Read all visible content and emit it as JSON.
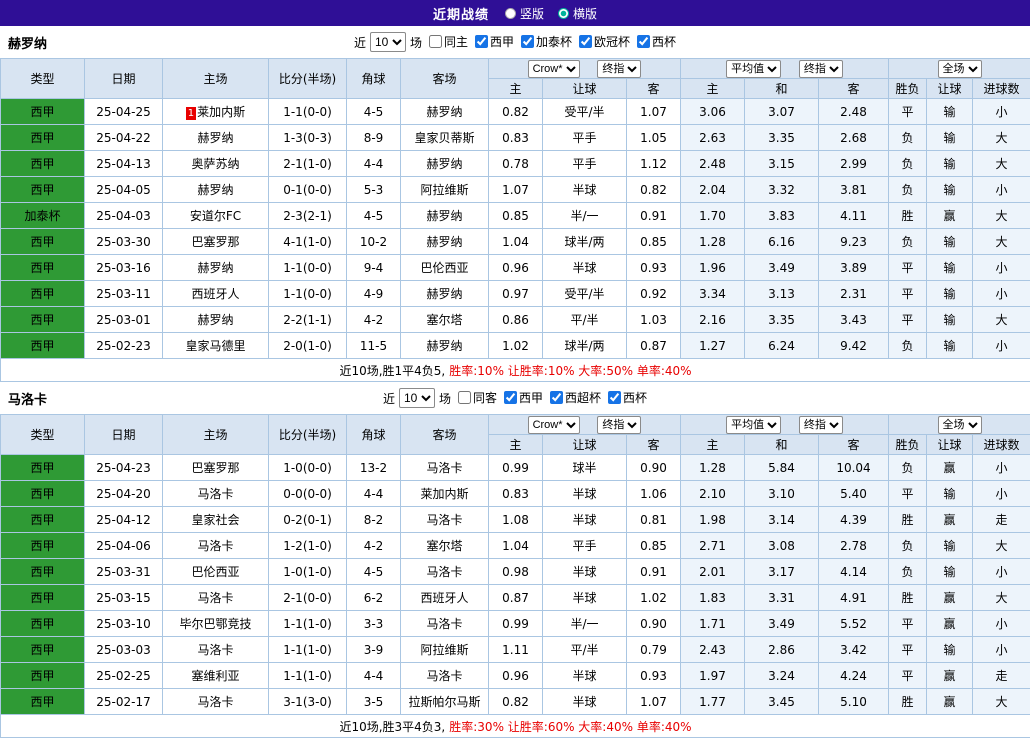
{
  "topbar": {
    "title": "近期战绩",
    "options": [
      {
        "label": "竖版",
        "selected": false
      },
      {
        "label": "横版",
        "selected": true
      }
    ]
  },
  "filter": {
    "near_label": "近",
    "count": "10",
    "games_label": "场"
  },
  "columns": {
    "type": "类型",
    "date": "日期",
    "home": "主场",
    "score": "比分(半场)",
    "corner": "角球",
    "away": "客场",
    "group1": {
      "selects": [
        "Crow*",
        "终指"
      ],
      "cols": [
        "主",
        "让球",
        "客"
      ]
    },
    "group2": {
      "selects": [
        "平均值",
        "终指"
      ],
      "cols": [
        "主",
        "和",
        "客"
      ]
    },
    "group3": {
      "selects": [
        "全场"
      ],
      "cols": [
        "胜负",
        "让球",
        "进球数"
      ]
    }
  },
  "sections": [
    {
      "team": "赫罗纳",
      "filter_checks": [
        {
          "label": "同主",
          "checked": false
        },
        {
          "label": "西甲",
          "checked": true
        },
        {
          "label": "加泰杯",
          "checked": true
        },
        {
          "label": "欧冠杯",
          "checked": true
        },
        {
          "label": "西杯",
          "checked": true
        }
      ],
      "rows": [
        {
          "type": "西甲",
          "date": "25-04-25",
          "home": "莱加内斯",
          "home_badge": "1",
          "score": "1-1(0-0)",
          "corner": "4-5",
          "away": "赫罗纳",
          "crow": [
            "0.82",
            "受平/半",
            "1.07"
          ],
          "avg": [
            "3.06",
            "3.07",
            "2.48"
          ],
          "result": [
            "平",
            "输",
            "小"
          ]
        },
        {
          "type": "西甲",
          "date": "25-04-22",
          "home": "赫罗纳",
          "score": "1-3(0-3)",
          "corner": "8-9",
          "away": "皇家贝蒂斯",
          "crow": [
            "0.83",
            "平手",
            "1.05"
          ],
          "avg": [
            "2.63",
            "3.35",
            "2.68"
          ],
          "result": [
            "负",
            "输",
            "大"
          ]
        },
        {
          "type": "西甲",
          "date": "25-04-13",
          "home": "奥萨苏纳",
          "score": "2-1(1-0)",
          "corner": "4-4",
          "away": "赫罗纳",
          "crow": [
            "0.78",
            "平手",
            "1.12"
          ],
          "avg": [
            "2.48",
            "3.15",
            "2.99"
          ],
          "result": [
            "负",
            "输",
            "大"
          ]
        },
        {
          "type": "西甲",
          "date": "25-04-05",
          "home": "赫罗纳",
          "score": "0-1(0-0)",
          "corner": "5-3",
          "away": "阿拉维斯",
          "crow": [
            "1.07",
            "半球",
            "0.82"
          ],
          "avg": [
            "2.04",
            "3.32",
            "3.81"
          ],
          "result": [
            "负",
            "输",
            "小"
          ]
        },
        {
          "type": "加泰杯",
          "date": "25-04-03",
          "home": "安道尔FC",
          "score": "2-3(2-1)",
          "corner": "4-5",
          "away": "赫罗纳",
          "crow": [
            "0.85",
            "半/一",
            "0.91"
          ],
          "avg": [
            "1.70",
            "3.83",
            "4.11"
          ],
          "result": [
            "胜",
            "赢",
            "大"
          ]
        },
        {
          "type": "西甲",
          "date": "25-03-30",
          "home": "巴塞罗那",
          "score": "4-1(1-0)",
          "corner": "10-2",
          "away": "赫罗纳",
          "crow": [
            "1.04",
            "球半/两",
            "0.85"
          ],
          "avg": [
            "1.28",
            "6.16",
            "9.23"
          ],
          "result": [
            "负",
            "输",
            "大"
          ]
        },
        {
          "type": "西甲",
          "date": "25-03-16",
          "home": "赫罗纳",
          "score": "1-1(0-0)",
          "corner": "9-4",
          "away": "巴伦西亚",
          "crow": [
            "0.96",
            "半球",
            "0.93"
          ],
          "avg": [
            "1.96",
            "3.49",
            "3.89"
          ],
          "result": [
            "平",
            "输",
            "小"
          ]
        },
        {
          "type": "西甲",
          "date": "25-03-11",
          "home": "西班牙人",
          "score": "1-1(0-0)",
          "corner": "4-9",
          "away": "赫罗纳",
          "crow": [
            "0.97",
            "受平/半",
            "0.92"
          ],
          "avg": [
            "3.34",
            "3.13",
            "2.31"
          ],
          "result": [
            "平",
            "输",
            "小"
          ]
        },
        {
          "type": "西甲",
          "date": "25-03-01",
          "home": "赫罗纳",
          "score": "2-2(1-1)",
          "corner": "4-2",
          "away": "塞尔塔",
          "crow": [
            "0.86",
            "平/半",
            "1.03"
          ],
          "avg": [
            "2.16",
            "3.35",
            "3.43"
          ],
          "result": [
            "平",
            "输",
            "大"
          ]
        },
        {
          "type": "西甲",
          "date": "25-02-23",
          "home": "皇家马德里",
          "score": "2-0(1-0)",
          "corner": "11-5",
          "away": "赫罗纳",
          "crow": [
            "1.02",
            "球半/两",
            "0.87"
          ],
          "avg": [
            "1.27",
            "6.24",
            "9.42"
          ],
          "result": [
            "负",
            "输",
            "小"
          ]
        }
      ],
      "summary_prefix": "近10场,胜1平4负5,",
      "summary_stats": "胜率:10% 让胜率:10% 大率:50% 单率:40%"
    },
    {
      "team": "马洛卡",
      "filter_checks": [
        {
          "label": "同客",
          "checked": false
        },
        {
          "label": "西甲",
          "checked": true
        },
        {
          "label": "西超杯",
          "checked": true
        },
        {
          "label": "西杯",
          "checked": true
        }
      ],
      "rows": [
        {
          "type": "西甲",
          "date": "25-04-23",
          "home": "巴塞罗那",
          "score": "1-0(0-0)",
          "corner": "13-2",
          "away": "马洛卡",
          "crow": [
            "0.99",
            "球半",
            "0.90"
          ],
          "avg": [
            "1.28",
            "5.84",
            "10.04"
          ],
          "result": [
            "负",
            "赢",
            "小"
          ]
        },
        {
          "type": "西甲",
          "date": "25-04-20",
          "home": "马洛卡",
          "score": "0-0(0-0)",
          "corner": "4-4",
          "away": "莱加内斯",
          "crow": [
            "0.83",
            "半球",
            "1.06"
          ],
          "avg": [
            "2.10",
            "3.10",
            "5.40"
          ],
          "result": [
            "平",
            "输",
            "小"
          ]
        },
        {
          "type": "西甲",
          "date": "25-04-12",
          "home": "皇家社会",
          "score": "0-2(0-1)",
          "corner": "8-2",
          "away": "马洛卡",
          "crow": [
            "1.08",
            "半球",
            "0.81"
          ],
          "avg": [
            "1.98",
            "3.14",
            "4.39"
          ],
          "result": [
            "胜",
            "赢",
            "走"
          ]
        },
        {
          "type": "西甲",
          "date": "25-04-06",
          "home": "马洛卡",
          "score": "1-2(1-0)",
          "corner": "4-2",
          "away": "塞尔塔",
          "crow": [
            "1.04",
            "平手",
            "0.85"
          ],
          "avg": [
            "2.71",
            "3.08",
            "2.78"
          ],
          "result": [
            "负",
            "输",
            "大"
          ]
        },
        {
          "type": "西甲",
          "date": "25-03-31",
          "home": "巴伦西亚",
          "score": "1-0(1-0)",
          "corner": "4-5",
          "away": "马洛卡",
          "crow": [
            "0.98",
            "半球",
            "0.91"
          ],
          "avg": [
            "2.01",
            "3.17",
            "4.14"
          ],
          "result": [
            "负",
            "输",
            "小"
          ]
        },
        {
          "type": "西甲",
          "date": "25-03-15",
          "home": "马洛卡",
          "score": "2-1(0-0)",
          "corner": "6-2",
          "away": "西班牙人",
          "crow": [
            "0.87",
            "半球",
            "1.02"
          ],
          "avg": [
            "1.83",
            "3.31",
            "4.91"
          ],
          "result": [
            "胜",
            "赢",
            "大"
          ]
        },
        {
          "type": "西甲",
          "date": "25-03-10",
          "home": "毕尔巴鄂竞技",
          "score": "1-1(1-0)",
          "corner": "3-3",
          "away": "马洛卡",
          "crow": [
            "0.99",
            "半/一",
            "0.90"
          ],
          "avg": [
            "1.71",
            "3.49",
            "5.52"
          ],
          "result": [
            "平",
            "赢",
            "小"
          ]
        },
        {
          "type": "西甲",
          "date": "25-03-03",
          "home": "马洛卡",
          "score": "1-1(1-0)",
          "corner": "3-9",
          "away": "阿拉维斯",
          "crow": [
            "1.11",
            "平/半",
            "0.79"
          ],
          "avg": [
            "2.43",
            "2.86",
            "3.42"
          ],
          "result": [
            "平",
            "输",
            "小"
          ]
        },
        {
          "type": "西甲",
          "date": "25-02-25",
          "home": "塞维利亚",
          "score": "1-1(1-0)",
          "corner": "4-4",
          "away": "马洛卡",
          "crow": [
            "0.96",
            "半球",
            "0.93"
          ],
          "avg": [
            "1.97",
            "3.24",
            "4.24"
          ],
          "result": [
            "平",
            "赢",
            "走"
          ]
        },
        {
          "type": "西甲",
          "date": "25-02-17",
          "home": "马洛卡",
          "score": "3-1(3-0)",
          "corner": "3-5",
          "away": "拉斯帕尔马斯",
          "crow": [
            "0.82",
            "半球",
            "1.07"
          ],
          "avg": [
            "1.77",
            "3.45",
            "5.10"
          ],
          "result": [
            "胜",
            "赢",
            "大"
          ]
        }
      ],
      "summary_prefix": "近10场,胜3平4负3,",
      "summary_stats": "胜率:30% 让胜率:60% 大率:40% 单率:40%"
    }
  ],
  "colors": {
    "topbar-bg": "#2f0f96",
    "type-green": "#2f9a35",
    "red": "#e80000",
    "green": "#008800",
    "blue": "#1515d6",
    "grid-line": "#aac6e2",
    "header-bg": "#d8e4f2",
    "tint": "#edf4fb",
    "radio-accent": "#00b39b"
  }
}
